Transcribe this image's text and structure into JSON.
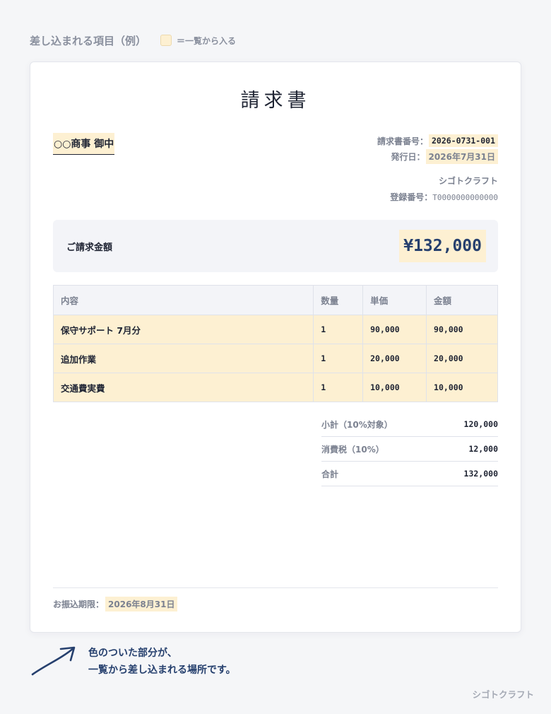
{
  "legend": {
    "title": "差し込まれる項目（例）",
    "swatch_text": "＝一覧から入る",
    "swatch_color": "#fdf0d2"
  },
  "document": {
    "title": "請求書",
    "client": "○○商事 御中",
    "invoice_no_label": "請求書番号：",
    "invoice_no": "2026-0731-001",
    "issue_date_label": "発行日：",
    "issue_date": "2026年7月31日",
    "issuer_name": "シゴトクラフト",
    "registration_label": "登録番号：",
    "registration_no": "T0000000000000"
  },
  "amount": {
    "label": "ご請求金額",
    "value": "¥132,000"
  },
  "items_table": {
    "headers": [
      "内容",
      "数量",
      "単価",
      "金額"
    ],
    "rows": [
      {
        "description": "保守サポート 7月分",
        "qty": "1",
        "unit_price": "90,000",
        "amount": "90,000"
      },
      {
        "description": "追加作業",
        "qty": "1",
        "unit_price": "20,000",
        "amount": "20,000"
      },
      {
        "description": "交通費実費",
        "qty": "1",
        "unit_price": "10,000",
        "amount": "10,000"
      }
    ]
  },
  "totals": [
    {
      "label": "小計（10%対象）",
      "value": "120,000"
    },
    {
      "label": "消費税（10%）",
      "value": "12,000"
    },
    {
      "label": "合計",
      "value": "132,000"
    }
  ],
  "deadline": {
    "label": "お振込期限：",
    "value": "2026年8月31日"
  },
  "note": {
    "line1": "色のついた部分が、",
    "line2": "一覧から差し込まれる場所です。"
  },
  "watermark": "シゴトクラフト",
  "colors": {
    "highlight": "#fdf0d2",
    "accent_navy": "#26406e",
    "muted_text": "#7b8190"
  }
}
